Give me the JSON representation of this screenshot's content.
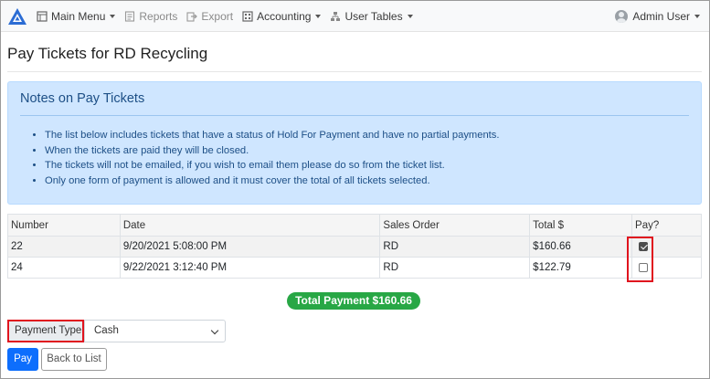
{
  "nav": {
    "main_menu": "Main Menu",
    "reports": "Reports",
    "export": "Export",
    "accounting": "Accounting",
    "user_tables": "User Tables",
    "user": "Admin User"
  },
  "page": {
    "title": "Pay Tickets for RD Recycling"
  },
  "notes": {
    "title": "Notes on Pay Tickets",
    "items": [
      "The list below includes tickets that have a status of Hold For Payment and have no partial payments.",
      "When the tickets are paid they will be closed.",
      "The tickets will not be emailed, if you wish to email them please do so from the ticket list.",
      "Only one form of payment is allowed and it must cover the total of all tickets selected."
    ]
  },
  "table": {
    "headers": [
      "Number",
      "Date",
      "Sales Order",
      "Total $",
      "Pay?"
    ],
    "rows": [
      {
        "number": "22",
        "date": "9/20/2021 5:08:00 PM",
        "sales_order": "RD",
        "total": "$160.66",
        "pay": true
      },
      {
        "number": "24",
        "date": "9/22/2021 3:12:40 PM",
        "sales_order": "RD",
        "total": "$122.79",
        "pay": false
      }
    ]
  },
  "total_payment": "Total Payment $160.66",
  "payment": {
    "label": "Payment Type",
    "selected": "Cash"
  },
  "buttons": {
    "pay": "Pay",
    "back": "Back to List"
  },
  "colors": {
    "accent": "#0d6efd",
    "success": "#28a745",
    "highlight": "#e0141e",
    "notes_bg": "#cfe6ff"
  }
}
